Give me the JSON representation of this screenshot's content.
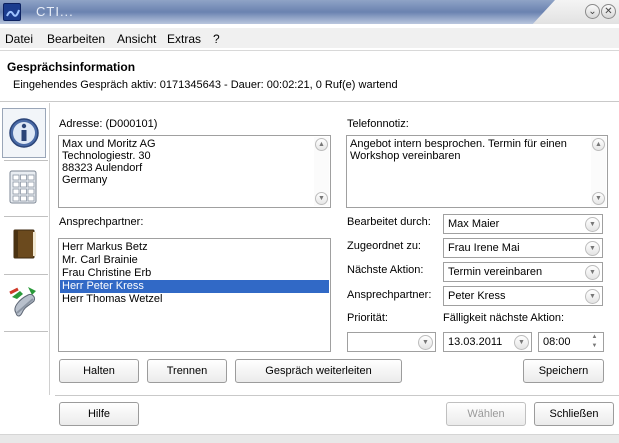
{
  "window": {
    "title": "CTI...",
    "min_glyph": "⌄",
    "close_glyph": "✕"
  },
  "menu": [
    {
      "label": "Datei"
    },
    {
      "label": "Bearbeiten"
    },
    {
      "label": "Ansicht"
    },
    {
      "label": "Extras"
    },
    {
      "label": "?"
    }
  ],
  "header": {
    "title": "Gesprächsinformation",
    "status": "Eingehendes Gespräch aktiv: 0171345643 - Dauer: 00:02:21, 0 Ruf(e) wartend"
  },
  "toolbar": {
    "icons": [
      "info-icon",
      "keypad-icon",
      "address-book-icon",
      "phone-transfer-icon"
    ]
  },
  "address": {
    "label": "Adresse: (D000101)",
    "lines": [
      "Max und Moritz AG",
      "Technologiestr. 30",
      "88323 Aulendorf",
      "Germany"
    ]
  },
  "note": {
    "label": "Telefonnotiz:",
    "text": "Angebot intern besprochen. Termin für einen Workshop vereinbaren"
  },
  "contacts": {
    "label": "Ansprechpartner:",
    "items": [
      "Herr Markus Betz",
      "Mr. Carl Brainie",
      "Frau Christine Erb",
      "Herr Peter Kress",
      "Herr Thomas Wetzel"
    ],
    "selected_index": 3
  },
  "fields": {
    "edited_by": {
      "label": "Bearbeitet durch:",
      "value": "Max Maier"
    },
    "assigned_to": {
      "label": "Zugeordnet zu:",
      "value": "Frau Irene Mai"
    },
    "next_action": {
      "label": "Nächste Aktion:",
      "value": "Termin vereinbaren"
    },
    "contact": {
      "label": "Ansprechpartner:",
      "value": "Peter Kress"
    },
    "priority": {
      "label": "Priorität:",
      "value": ""
    },
    "due": {
      "label": "Fälligkeit nächste Aktion:",
      "date": "13.03.2011",
      "time": "08:00"
    }
  },
  "buttons": {
    "halten": "Halten",
    "trennen": "Trennen",
    "forward": "Gespräch weiterleiten",
    "save": "Speichern",
    "help": "Hilfe",
    "choose": "Wählen",
    "close": "Schließen"
  },
  "colors": {
    "selection": "#3169c6",
    "title_bar": "#6a82b0"
  }
}
